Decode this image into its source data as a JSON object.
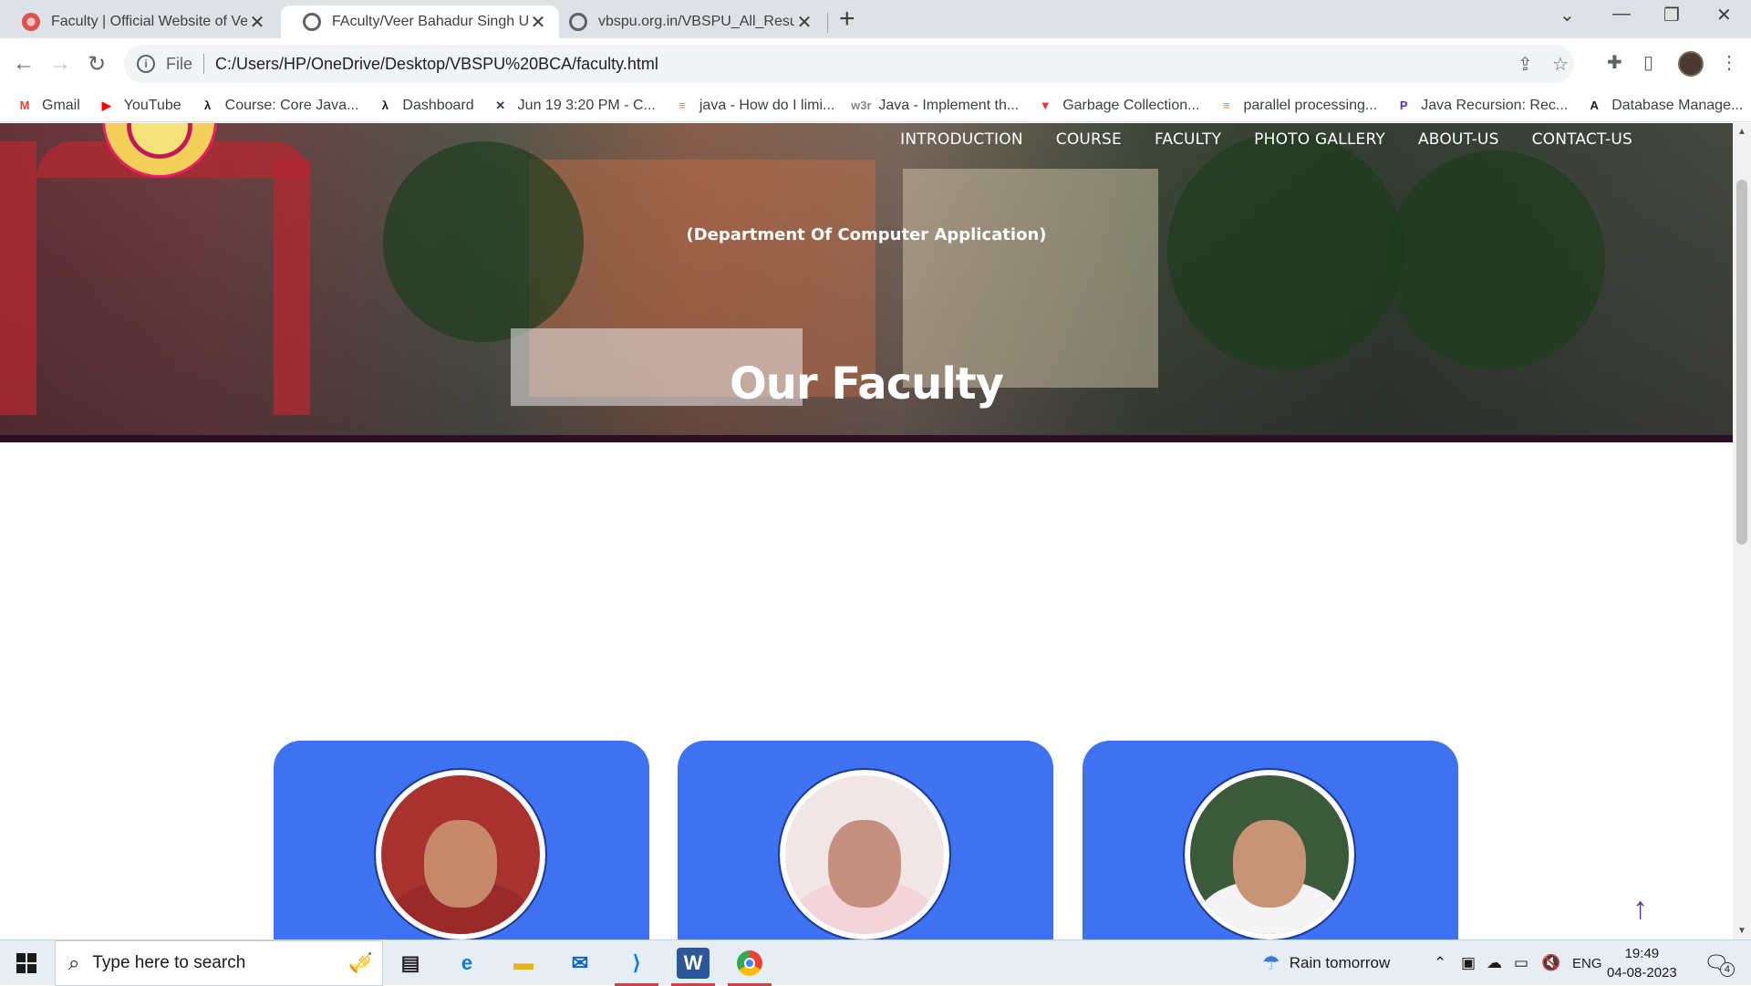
{
  "browser": {
    "tabs": [
      {
        "title": "Faculty | Official Website of Veer Bahadur Singh Purvanchal University",
        "active": false,
        "favicon_color": "#d9534f"
      },
      {
        "title": "FAculty/Veer Bahadur Singh University",
        "active": true,
        "favicon_color": "#5f6368"
      },
      {
        "title": "vbspu.org.in/VBSPU_All_Results.aspx",
        "active": false,
        "favicon_color": "#5f6368"
      }
    ],
    "new_tab_label": "+",
    "address_scheme": "File",
    "address_url": "C:/Users/HP/OneDrive/Desktop/VBSPU%20BCA/faculty.html",
    "bookmarks": [
      {
        "label": "Gmail",
        "icon": "gmail-icon",
        "glyph": "M",
        "color": "#ea4335"
      },
      {
        "label": "YouTube",
        "icon": "youtube-icon",
        "glyph": "▶",
        "color": "#ff0000"
      },
      {
        "label": "Course: Core Java...",
        "icon": "course-icon",
        "glyph": "λ",
        "color": "#1a1a1a"
      },
      {
        "label": "Dashboard",
        "icon": "dashboard-icon",
        "glyph": "λ",
        "color": "#1a1a1a"
      },
      {
        "label": "Jun 19 3:20 PM - C...",
        "icon": "meeting-icon",
        "glyph": "✕",
        "color": "#2d3b5a"
      },
      {
        "label": "java - How do I limi...",
        "icon": "stackoverflow-icon",
        "glyph": "≡",
        "color": "#f48024"
      },
      {
        "label": "Java - Implement th...",
        "icon": "w3resource-icon",
        "glyph": "w3r",
        "color": "#888888"
      },
      {
        "label": "Garbage Collection...",
        "icon": "geeks-icon",
        "glyph": "▼",
        "color": "#e53935"
      },
      {
        "label": "parallel processing...",
        "icon": "stackoverflow-icon",
        "glyph": "≡",
        "color": "#f48024"
      },
      {
        "label": "Java Recursion: Rec...",
        "icon": "programiz-icon",
        "glyph": "P",
        "color": "#5b2fd0"
      },
      {
        "label": "Database Manage...",
        "icon": "database-icon",
        "glyph": "A",
        "color": "#1a1a1a"
      }
    ]
  },
  "page": {
    "nav": [
      "INTRODUCTION",
      "COURSE",
      "FACULTY",
      "PHOTO GALLERY",
      "ABOUT-US",
      "CONTACT-US"
    ],
    "department": "(Department Of Computer Application)",
    "title": "Our Faculty",
    "card_color": "#3f72f0",
    "faculty": [
      {
        "photo": "faculty-photo-1",
        "bg": "#a8322e",
        "skin": "#c68a6a",
        "clothes": "#9a2a2a"
      },
      {
        "photo": "faculty-photo-2",
        "bg": "#f1e6e6",
        "skin": "#c59080",
        "clothes": "#f3d4d8"
      },
      {
        "photo": "faculty-photo-3",
        "bg": "#3a5a3a",
        "skin": "#c89478",
        "clothes": "#f4f4f4"
      }
    ]
  },
  "taskbar": {
    "search_placeholder": "Type here to search",
    "weather": "Rain tomorrow",
    "language": "ENG",
    "time": "19:49",
    "date": "04-08-2023",
    "notification_count": "4"
  }
}
